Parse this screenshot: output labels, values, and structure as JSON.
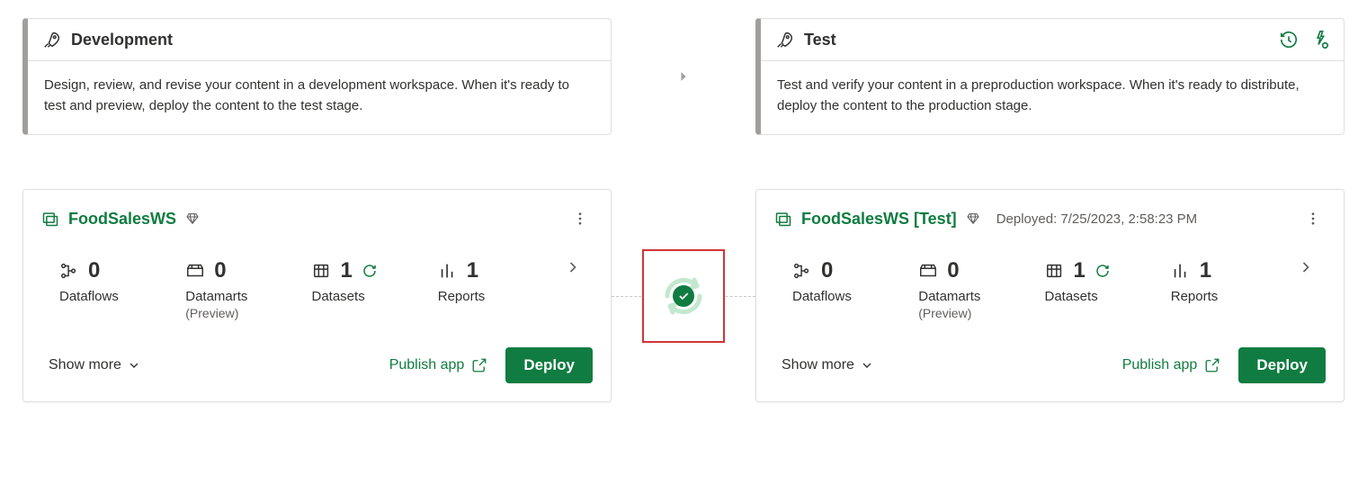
{
  "stages": {
    "dev": {
      "title": "Development",
      "desc": "Design, review, and revise your content in a development workspace. When it's ready to test and preview, deploy the content to the test stage."
    },
    "test": {
      "title": "Test",
      "desc": "Test and verify your content in a preproduction workspace. When it's ready to distribute, deploy the content to the production stage."
    }
  },
  "workspaces": {
    "dev": {
      "name": "FoodSalesWS",
      "metrics": {
        "dataflows": {
          "label": "Dataflows",
          "value": "0"
        },
        "datamarts": {
          "label": "Datamarts",
          "sub": "(Preview)",
          "value": "0"
        },
        "datasets": {
          "label": "Datasets",
          "value": "1"
        },
        "reports": {
          "label": "Reports",
          "value": "1"
        }
      }
    },
    "test": {
      "name": "FoodSalesWS [Test]",
      "deployed": "Deployed: 7/25/2023, 2:58:23 PM",
      "metrics": {
        "dataflows": {
          "label": "Dataflows",
          "value": "0"
        },
        "datamarts": {
          "label": "Datamarts",
          "sub": "(Preview)",
          "value": "0"
        },
        "datasets": {
          "label": "Datasets",
          "value": "1"
        },
        "reports": {
          "label": "Reports",
          "value": "1"
        }
      }
    }
  },
  "actions": {
    "show_more": "Show more",
    "publish_app": "Publish app",
    "deploy": "Deploy"
  }
}
